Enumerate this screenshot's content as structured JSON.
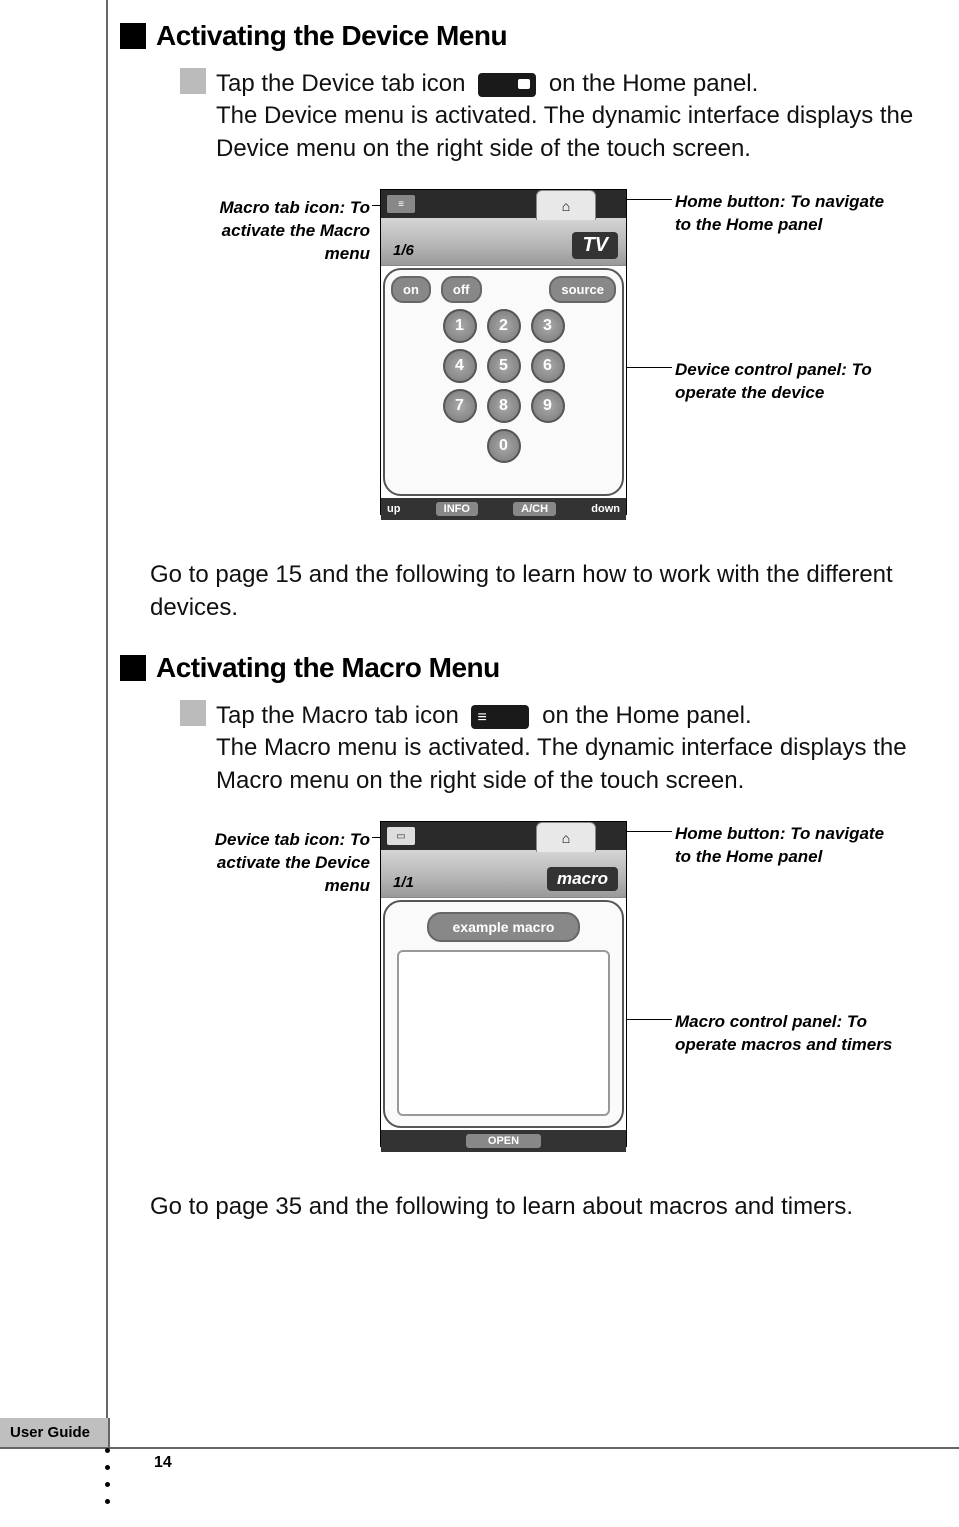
{
  "sections": {
    "device": {
      "heading": "Activating the Device Menu",
      "step_pre": "Tap the Device tab icon ",
      "step_post": " on the Home panel.",
      "desc": "The Device menu is activated. The dynamic interface displays the Device menu on the right side of the touch screen.",
      "callouts": {
        "left1": "Macro tab icon: To activate the Macro menu",
        "right1": "Home button: To navigate to the Home panel",
        "right2": "Device control panel: To operate the device"
      },
      "screen": {
        "page": "1/6",
        "tab_label": "TV",
        "home_glyph": "⌂",
        "on": "on",
        "off": "off",
        "source": "source",
        "n1": "1",
        "n2": "2",
        "n3": "3",
        "n4": "4",
        "n5": "5",
        "n6": "6",
        "n7": "7",
        "n8": "8",
        "n9": "9",
        "n0": "0",
        "foot_up": "up",
        "foot_info": "INFO",
        "foot_avch": "A/CH",
        "foot_down": "down"
      },
      "outro": "Go to page 15 and the following to learn how to work with the different devices."
    },
    "macro": {
      "heading": "Activating the Macro Menu",
      "step_pre": "Tap the Macro tab icon ",
      "step_post": " on the Home panel.",
      "desc": "The Macro menu is activated. The dynamic interface displays the Macro menu on the right side of the touch screen.",
      "callouts": {
        "left1": "Device tab icon: To activate the Device menu",
        "right1": "Home button: To navigate to the Home panel",
        "right2": "Macro control panel: To operate macros and timers"
      },
      "screen": {
        "page": "1/1",
        "tab_label": "macro",
        "home_glyph": "⌂",
        "example": "example macro",
        "foot_open": "OPEN"
      },
      "outro": "Go to page 35 and the following to learn about macros and timers."
    }
  },
  "footer": {
    "tab": "User Guide",
    "page": "14"
  }
}
